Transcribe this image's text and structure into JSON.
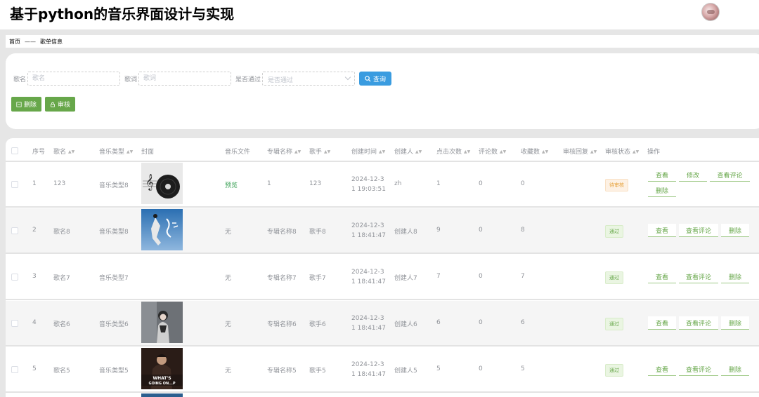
{
  "app": {
    "title": "基于python的音乐界面设计与实现"
  },
  "breadcrumb": {
    "home": "首页",
    "separator": "——",
    "current": "歌单信息"
  },
  "search": {
    "song_name_label": "歌名",
    "song_name_placeholder": "歌名",
    "lyrics_label": "歌词",
    "lyrics_placeholder": "歌词",
    "approved_label": "是否通过",
    "approved_placeholder": "是否通过",
    "query_button": "查询"
  },
  "actions": {
    "delete_button": "删除",
    "review_button": "审核"
  },
  "table": {
    "headers": [
      "序号",
      "歌名",
      "音乐类型",
      "封面",
      "音乐文件",
      "专辑名称",
      "歌手",
      "创建时间",
      "创建人",
      "点击次数",
      "评论数",
      "收藏数",
      "审核回复",
      "审核状态",
      "操作"
    ],
    "rows": [
      {
        "index": "1",
        "name": "123",
        "type": "音乐类型8",
        "file": "预览",
        "album": "1",
        "singer": "123",
        "time": "2024-12-3 1 19:03:51",
        "creator": "zh",
        "clicks": "1",
        "comments": "0",
        "favorites": "0",
        "reply": "",
        "status": "待审核",
        "ops": [
          "查看",
          "修改",
          "查看评论",
          "删除"
        ]
      },
      {
        "index": "2",
        "name": "歌名8",
        "type": "音乐类型8",
        "file": "无",
        "album": "专辑名称8",
        "singer": "歌手8",
        "time": "2024-12-3 1 18:41:47",
        "creator": "创建人8",
        "clicks": "9",
        "comments": "0",
        "favorites": "8",
        "reply": "",
        "status": "通过",
        "ops": [
          "查看",
          "查看评论",
          "删除"
        ]
      },
      {
        "index": "3",
        "name": "歌名7",
        "type": "音乐类型7",
        "file": "无",
        "album": "专辑名称7",
        "singer": "歌手7",
        "time": "2024-12-3 1 18:41:47",
        "creator": "创建人7",
        "clicks": "7",
        "comments": "0",
        "favorites": "7",
        "reply": "",
        "status": "通过",
        "ops": [
          "查看",
          "查看评论",
          "删除"
        ]
      },
      {
        "index": "4",
        "name": "歌名6",
        "type": "音乐类型6",
        "file": "无",
        "album": "专辑名称6",
        "singer": "歌手6",
        "time": "2024-12-3 1 18:41:47",
        "creator": "创建人6",
        "clicks": "6",
        "comments": "0",
        "favorites": "6",
        "reply": "",
        "status": "通过",
        "ops": [
          "查看",
          "查看评论",
          "删除"
        ]
      },
      {
        "index": "5",
        "name": "歌名5",
        "type": "音乐类型5",
        "file": "无",
        "album": "专辑名称5",
        "singer": "歌手5",
        "time": "2024-12-3 1 18:41:47",
        "creator": "创建人5",
        "clicks": "5",
        "comments": "0",
        "favorites": "5",
        "reply": "",
        "status": "通过",
        "ops": [
          "查看",
          "查看评论",
          "删除"
        ]
      }
    ]
  },
  "covers": {
    "row5_text": "WHAT'S GOING ON...P"
  },
  "colors": {
    "accent_blue": "#3a9ce0",
    "accent_green": "#67a74a",
    "pending_orange": "#e6a23c"
  }
}
